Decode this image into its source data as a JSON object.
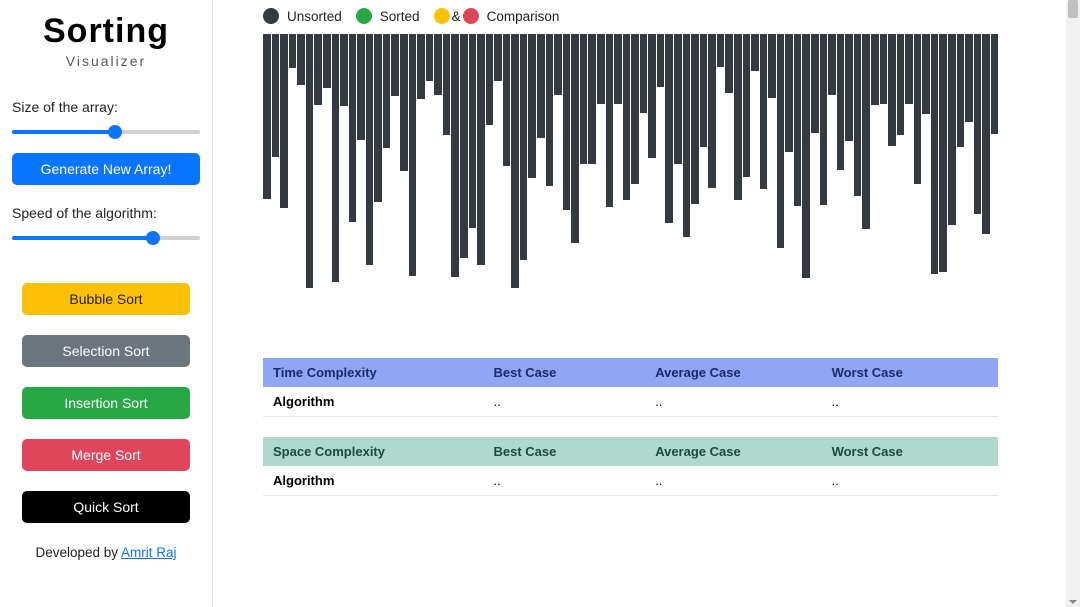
{
  "header": {
    "title": "Sorting",
    "subtitle": "Visualizer"
  },
  "sidebar": {
    "array_size_label": "Size of the array:",
    "array_size_pct": 55,
    "generate_label": "Generate New Array!",
    "speed_label": "Speed of the algorithm:",
    "speed_pct": 75,
    "buttons": [
      {
        "label": "Bubble Sort",
        "color": "#ffc107",
        "text": "#222"
      },
      {
        "label": "Selection Sort",
        "color": "#6c757d",
        "text": "#fff"
      },
      {
        "label": "Insertion Sort",
        "color": "#28a745",
        "text": "#fff"
      },
      {
        "label": "Merge Sort",
        "color": "#e0465b",
        "text": "#fff"
      },
      {
        "label": "Quick Sort",
        "color": "#000000",
        "text": "#fff"
      }
    ]
  },
  "footer": {
    "prefix": "Developed by ",
    "author": "Amrit Raj"
  },
  "legend": {
    "items": [
      {
        "color": "#343a40",
        "label": "Unsorted"
      },
      {
        "color": "#28a745",
        "label": "Sorted"
      }
    ],
    "comparison": {
      "colors": [
        "#ffc107",
        "#e0465b"
      ],
      "label": "Comparison",
      "joiner": "&"
    }
  },
  "chart_data": {
    "type": "bar",
    "title": "",
    "xlabel": "",
    "ylabel": "",
    "ylim": [
      0,
      262
    ],
    "note": "Unsorted array bars; y is bar height in px (hang from top)",
    "values": [
      165,
      123,
      174,
      34,
      51,
      254,
      71,
      54,
      248,
      72,
      188,
      106,
      231,
      168,
      114,
      62,
      137,
      242,
      65,
      47,
      61,
      101,
      243,
      224,
      194,
      231,
      91,
      47,
      132,
      254,
      226,
      144,
      104,
      152,
      61,
      176,
      209,
      130,
      130,
      70,
      173,
      70,
      166,
      150,
      79,
      124,
      53,
      189,
      130,
      203,
      170,
      113,
      154,
      33,
      59,
      166,
      143,
      37,
      155,
      64,
      214,
      118,
      172,
      244,
      99,
      171,
      61,
      136,
      107,
      162,
      195,
      71,
      70,
      112,
      101,
      70,
      150,
      80,
      240,
      238,
      191,
      113,
      88,
      180,
      200,
      100
    ],
    "color": "#343a40"
  },
  "tables": {
    "time": {
      "header": [
        "Time Complexity",
        "Best Case",
        "Average Case",
        "Worst Case"
      ],
      "rows": [
        [
          "Algorithm",
          "..",
          "..",
          ".."
        ]
      ]
    },
    "space": {
      "header": [
        "Space Complexity",
        "Best Case",
        "Average Case",
        "Worst Case"
      ],
      "rows": [
        [
          "Algorithm",
          "..",
          "..",
          ".."
        ]
      ]
    }
  }
}
